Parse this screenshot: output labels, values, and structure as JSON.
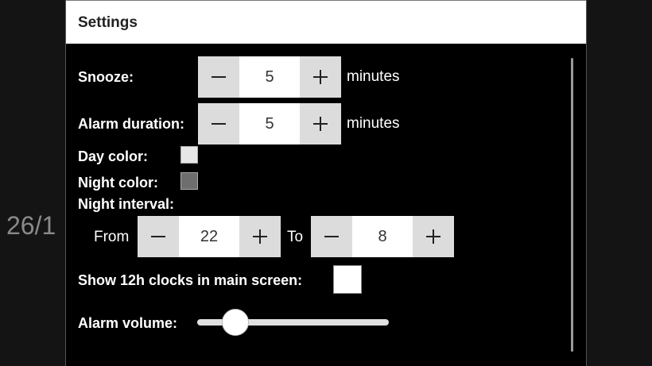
{
  "background": {
    "date_fragment": "26/1"
  },
  "dialog": {
    "title": "Settings",
    "snooze": {
      "label": "Snooze:",
      "value": "5",
      "unit": "minutes"
    },
    "alarm_duration": {
      "label": "Alarm duration:",
      "value": "5",
      "unit": "minutes"
    },
    "day_color": {
      "label": "Day color:",
      "color": "#e6e6e6"
    },
    "night_color": {
      "label": "Night color:",
      "color": "#6e6e6e"
    },
    "night_interval": {
      "label": "Night interval:",
      "from_label": "From",
      "from_value": "22",
      "to_label": "To",
      "to_value": "8"
    },
    "show_12h": {
      "label": "Show 12h clocks in main screen:",
      "checked": false
    },
    "alarm_volume": {
      "label": "Alarm volume:",
      "level": 0.2
    }
  }
}
